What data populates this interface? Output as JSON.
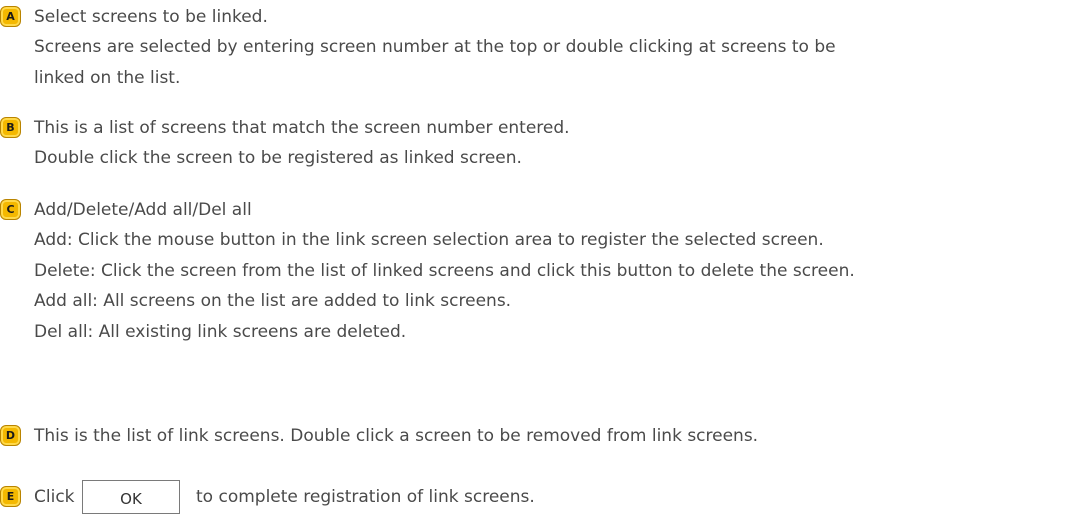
{
  "items": {
    "a": {
      "badge": "A",
      "title": "Select screens to be linked.",
      "lines": [
        "Screens are selected by entering screen number at the top or double clicking at screens to be",
        "linked on the list."
      ]
    },
    "b": {
      "badge": "B",
      "title": "This is a list of screens that match the screen number entered.",
      "lines": [
        "Double click the screen to be registered as linked screen."
      ]
    },
    "c": {
      "badge": "C",
      "title": "Add/Delete/Add all/Del all",
      "lines": [
        "Add: Click the mouse button in the link screen selection area to register the selected screen.",
        "Delete: Click the screen from the list of linked screens and click this button to delete the screen.",
        "Add all: All screens on the list are added to link screens.",
        "Del all: All existing link screens are deleted."
      ]
    },
    "d": {
      "badge": "D",
      "title": "This is the list of link screens. Double click a screen to be removed from link screens."
    },
    "e": {
      "badge": "E",
      "click_text": "Click",
      "ok_label": "OK",
      "after_text": "to complete registration of link screens."
    }
  }
}
